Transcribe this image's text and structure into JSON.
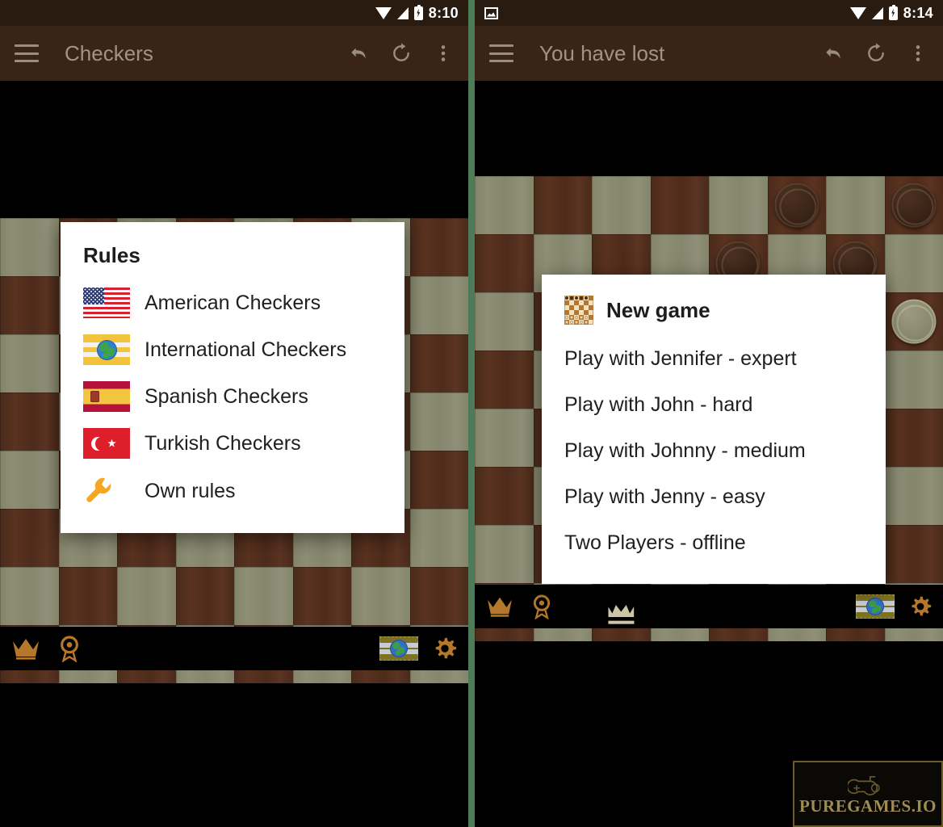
{
  "panels": {
    "left": {
      "status": {
        "time": "8:10",
        "wifi_icon": "wifi-icon",
        "signal_icon": "signal-icon",
        "battery_icon": "battery-charging-icon"
      },
      "appbar": {
        "menu_icon": "hamburger-menu-icon",
        "title": "Checkers",
        "undo_icon": "undo-icon",
        "redo_icon": "redo-icon",
        "overflow_icon": "overflow-menu-icon"
      },
      "dialog": {
        "title": "Rules",
        "items": [
          {
            "label": "American Checkers",
            "icon": "flag-us-icon"
          },
          {
            "label": "International Checkers",
            "icon": "flag-international-icon"
          },
          {
            "label": "Spanish Checkers",
            "icon": "flag-spain-icon"
          },
          {
            "label": "Turkish Checkers",
            "icon": "flag-turkey-icon"
          },
          {
            "label": "Own rules",
            "icon": "wrench-icon"
          }
        ]
      },
      "bottombar": {
        "crown_icon": "crown-icon",
        "award_icon": "award-medal-icon",
        "rules_flag_icon": "flag-international-icon",
        "settings_icon": "gear-icon"
      }
    },
    "right": {
      "status": {
        "time": "8:14",
        "screenshot_icon": "image-notification-icon",
        "wifi_icon": "wifi-icon",
        "signal_icon": "signal-icon",
        "battery_icon": "battery-charging-icon"
      },
      "appbar": {
        "menu_icon": "hamburger-menu-icon",
        "title": "You have lost",
        "undo_icon": "undo-icon",
        "redo_icon": "redo-icon",
        "overflow_icon": "overflow-menu-icon"
      },
      "dialog": {
        "title": "New game",
        "icon": "checkerboard-icon",
        "items": [
          {
            "label": "Play with Jennifer - expert"
          },
          {
            "label": "Play with John - hard"
          },
          {
            "label": "Play with Johnny - medium"
          },
          {
            "label": "Play with Jenny - easy"
          },
          {
            "label": "Two Players - offline"
          }
        ]
      },
      "bottombar": {
        "crown_icon": "crown-icon",
        "award_icon": "award-medal-icon",
        "rules_flag_icon": "flag-international-icon",
        "settings_icon": "gear-icon"
      }
    }
  },
  "watermark": {
    "text": "PUREGAMES.IO",
    "icon": "gamepad-icon"
  },
  "colors": {
    "board_dark": "#4e2b1b",
    "board_light": "#85866c",
    "appbar": "#3a2417",
    "statusbar": "#2a1b11",
    "divider_green": "#4d7a57",
    "accent_gold": "#b5782a",
    "dialog_bg": "#ffffff"
  },
  "board_left": {
    "rows": 8,
    "cols": 8,
    "pieces": []
  },
  "board_right": {
    "rows": 8,
    "cols": 8,
    "pieces": [
      {
        "row": 0,
        "col": 5,
        "type": "dark"
      },
      {
        "row": 0,
        "col": 7,
        "type": "dark"
      },
      {
        "row": 1,
        "col": 4,
        "type": "dark"
      },
      {
        "row": 1,
        "col": 6,
        "type": "dark"
      },
      {
        "row": 2,
        "col": 7,
        "type": "light"
      },
      {
        "row": 7,
        "col": 2,
        "type": "king-dark"
      }
    ]
  }
}
